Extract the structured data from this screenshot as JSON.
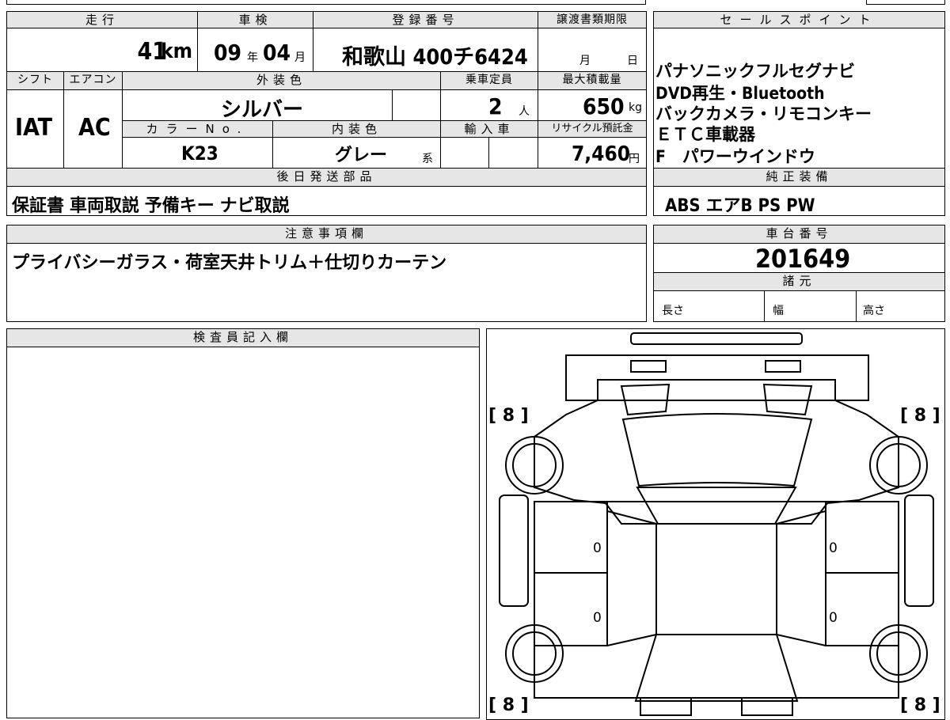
{
  "top": {
    "mileage_label": "走行",
    "mileage_value": "41",
    "mileage_unit": "km",
    "shaken_label": "車検",
    "shaken_year": "09",
    "shaken_year_unit": "年",
    "shaken_month": "04",
    "shaken_month_unit": "月",
    "reg_label": "登録番号",
    "reg_value": "和歌山 400チ6424",
    "transfer_label": "譲渡書類期限",
    "transfer_month_unit": "月",
    "transfer_day_unit": "日"
  },
  "row2": {
    "shift_label": "シフト",
    "shift_value": "IAT",
    "ac_label": "エアコン",
    "ac_value": "AC",
    "exterior_label": "外装色",
    "exterior_value": "シルバー",
    "capacity_label": "乗車定員",
    "capacity_value": "2",
    "capacity_unit": "人",
    "maxload_label": "最大積載量",
    "maxload_value": "650",
    "maxload_unit": "kg",
    "color_no_label": "カラーNo.",
    "color_no_value": "K23",
    "interior_label": "内装色",
    "interior_value": "グレー",
    "interior_suffix": "系",
    "import_label": "輸入車",
    "recycle_label": "リサイクル預託金",
    "recycle_value": "7,460",
    "recycle_unit": "円"
  },
  "sales": {
    "label": "セールスポイント",
    "lines": [
      "パナソニックフルセグナビ",
      "DVD再生・Bluetooth",
      "バックカメラ・リモコンキー",
      "ＥＴＣ車載器",
      "F　パワーウインドウ"
    ]
  },
  "later_parts": {
    "label": "後日発送部品",
    "value": "保証書 車両取説 予備キー ナビ取説"
  },
  "genuine": {
    "label": "純正装備",
    "value": "ABS エアB PS PW"
  },
  "notes": {
    "label": "注意事項欄",
    "value": "プライバシーガラス・荷室天井トリム＋仕切りカーテン"
  },
  "chassis": {
    "label": "車台番号",
    "value": "201649",
    "spec_label": "諸元",
    "length_label": "長さ",
    "width_label": "幅",
    "height_label": "高さ"
  },
  "inspector": {
    "label": "検査員記入欄"
  },
  "diagram": {
    "tire_fl": "[ 8 ]",
    "tire_fr": "[ 8 ]",
    "tire_rl": "[ 8 ]",
    "tire_rr": "[ 8 ]",
    "panel_mark_1": "0",
    "panel_mark_2": "0",
    "panel_mark_3": "0",
    "panel_mark_4": "0"
  }
}
